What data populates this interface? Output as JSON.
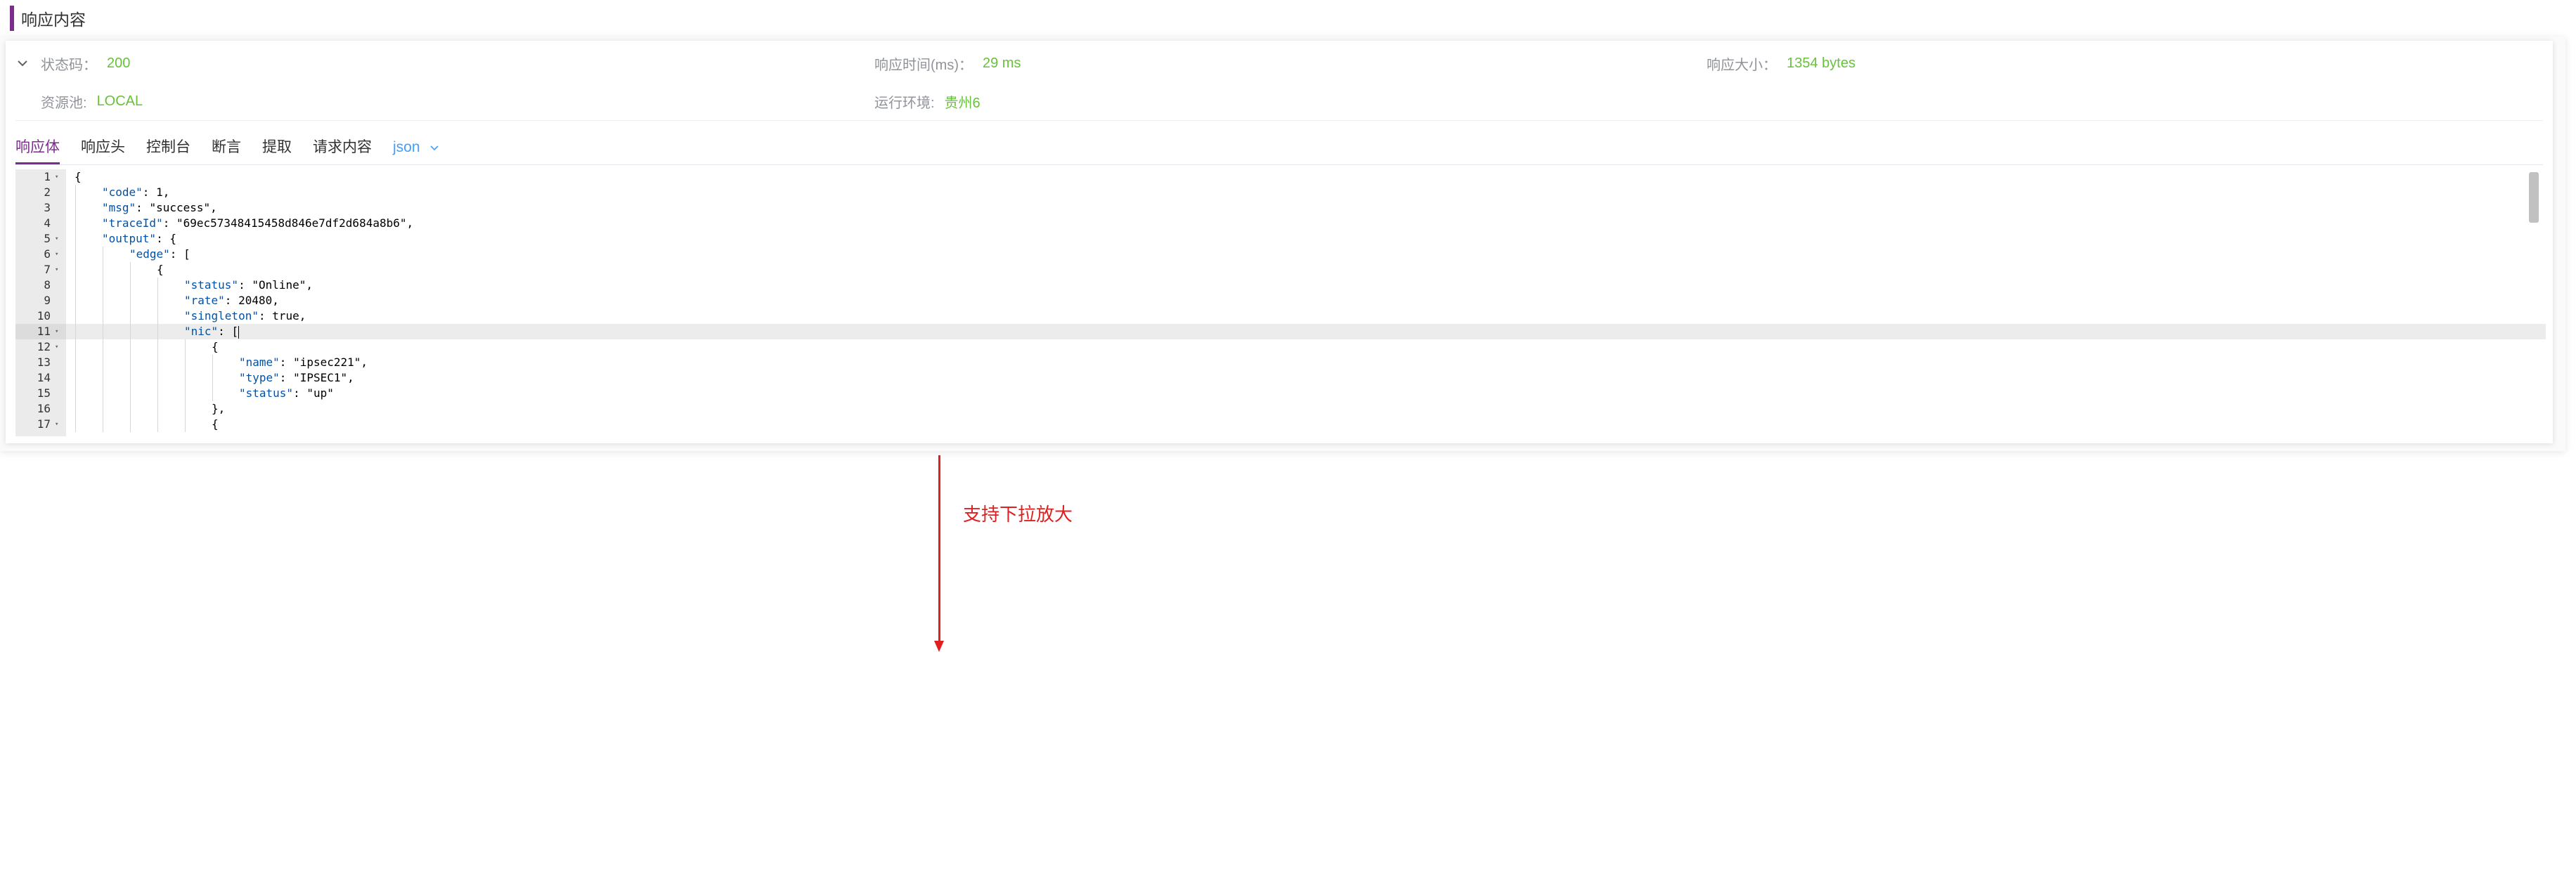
{
  "header": {
    "title": "响应内容"
  },
  "info": {
    "status_code": {
      "label": "状态码：",
      "value": "200"
    },
    "response_time": {
      "label": "响应时间(ms)：",
      "value": "29 ms"
    },
    "response_size": {
      "label": "响应大小：",
      "value": "1354 bytes"
    },
    "resource_pool": {
      "label": "资源池:",
      "value": "LOCAL"
    },
    "run_env": {
      "label": "运行环境:",
      "value": "贵州6"
    }
  },
  "tabs": [
    {
      "label": "响应体",
      "active": true
    },
    {
      "label": "响应头",
      "active": false
    },
    {
      "label": "控制台",
      "active": false
    },
    {
      "label": "断言",
      "active": false
    },
    {
      "label": "提取",
      "active": false
    },
    {
      "label": "请求内容",
      "active": false
    }
  ],
  "format_select": {
    "value": "json"
  },
  "editor": {
    "active_line": 11,
    "lines": [
      {
        "n": "1",
        "fold": true,
        "indent": 0,
        "text": "{"
      },
      {
        "n": "2",
        "fold": false,
        "indent": 1,
        "text": "\"code\": 1,"
      },
      {
        "n": "3",
        "fold": false,
        "indent": 1,
        "text": "\"msg\": \"success\","
      },
      {
        "n": "4",
        "fold": false,
        "indent": 1,
        "text": "\"traceId\": \"69ec57348415458d846e7df2d684a8b6\","
      },
      {
        "n": "5",
        "fold": true,
        "indent": 1,
        "text": "\"output\": {"
      },
      {
        "n": "6",
        "fold": true,
        "indent": 2,
        "text": "\"edge\": ["
      },
      {
        "n": "7",
        "fold": true,
        "indent": 3,
        "text": "{"
      },
      {
        "n": "8",
        "fold": false,
        "indent": 4,
        "text": "\"status\": \"Online\","
      },
      {
        "n": "9",
        "fold": false,
        "indent": 4,
        "text": "\"rate\": 20480,"
      },
      {
        "n": "10",
        "fold": false,
        "indent": 4,
        "text": "\"singleton\": true,"
      },
      {
        "n": "11",
        "fold": true,
        "indent": 4,
        "text": "\"nic\": ["
      },
      {
        "n": "12",
        "fold": true,
        "indent": 5,
        "text": "{"
      },
      {
        "n": "13",
        "fold": false,
        "indent": 6,
        "text": "\"name\": \"ipsec221\","
      },
      {
        "n": "14",
        "fold": false,
        "indent": 6,
        "text": "\"type\": \"IPSEC1\","
      },
      {
        "n": "15",
        "fold": false,
        "indent": 6,
        "text": "\"status\": \"up\""
      },
      {
        "n": "16",
        "fold": false,
        "indent": 5,
        "text": "},"
      },
      {
        "n": "17",
        "fold": true,
        "indent": 5,
        "text": "{"
      }
    ]
  },
  "annotation": {
    "text": "支持下拉放大"
  },
  "colors": {
    "accent": "#7b2d8e",
    "value_green": "#67c23a",
    "link_blue": "#409eff",
    "annotation_red": "#e02020"
  }
}
